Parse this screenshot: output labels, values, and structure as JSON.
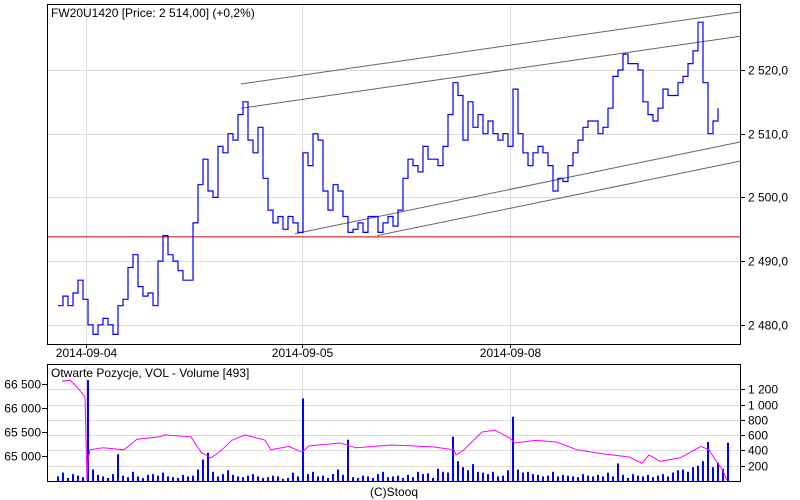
{
  "chart_data": [
    {
      "type": "line",
      "title": "FW20U1420 [Price: 2 514,00] (+0,2%)",
      "x_ticks": [
        {
          "label": "2014-09-04",
          "t": 5.6
        },
        {
          "label": "2014-09-05",
          "t": 48.8
        },
        {
          "label": "2014-09-08",
          "t": 90.4
        }
      ],
      "xlim": [
        -2.2,
        136.4
      ],
      "y_ticks": [
        {
          "label": "2 520,0",
          "value": 2520
        },
        {
          "label": "2 510,0",
          "value": 2510
        },
        {
          "label": "2 500,0",
          "value": 2500
        },
        {
          "label": "2 490,0",
          "value": 2490
        },
        {
          "label": "2 480,0",
          "value": 2480
        }
      ],
      "grid": true,
      "series": [
        {
          "name": "FW20U1420",
          "color": "#0000ff",
          "values": [
            2483,
            2484.5,
            2483,
            2485,
            2487,
            2484,
            2480,
            2478.5,
            2480,
            2481,
            2480,
            2478.5,
            2483,
            2484,
            2489,
            2491,
            2486,
            2484.5,
            2485,
            2483,
            2490,
            2494,
            2491,
            2490,
            2488.5,
            2487,
            2487,
            2496,
            2502,
            2506,
            2501,
            2500,
            2508,
            2507,
            2510,
            2509,
            2513,
            2515,
            2509,
            2507,
            2511,
            2503,
            2498,
            2496,
            2497,
            2495,
            2497,
            2496,
            2494.5,
            2507,
            2505,
            2510,
            2509,
            2501,
            2498,
            2502,
            2501,
            2497,
            2494.5,
            2495,
            2496,
            2494.5,
            2497,
            2497,
            2494.5,
            2496,
            2497,
            2495.5,
            2498,
            2503,
            2506,
            2505,
            2504,
            2508,
            2506,
            2506,
            2505,
            2508,
            2513,
            2518,
            2516,
            2509,
            2515,
            2511,
            2513,
            2510,
            2512,
            2510,
            2509,
            2510,
            2508,
            2517,
            2510,
            2507,
            2505,
            2507,
            2508,
            2507,
            2505,
            2501,
            2503,
            2502.5,
            2505,
            2507,
            2509,
            2511,
            2512,
            2512,
            2510,
            2511,
            2514,
            2519,
            2520,
            2522.5,
            2521,
            2521,
            2520,
            2515,
            2513,
            2512,
            2514,
            2517,
            2516,
            2516,
            2518,
            2519,
            2521,
            2523,
            2527.5,
            2518,
            2510,
            2512,
            2514
          ]
        }
      ],
      "reference_line": {
        "value": 2493.8,
        "color": "#cc0000"
      },
      "trendlines": [
        {
          "from": [
            36.6,
            2517.8
          ],
          "to": [
            136.4,
            2529.1
          ]
        },
        {
          "from": [
            36.6,
            2514.0
          ],
          "to": [
            136.4,
            2525.3
          ]
        },
        {
          "from": [
            47.4,
            2494.3
          ],
          "to": [
            136.4,
            2508.7
          ]
        },
        {
          "from": [
            63.8,
            2494.0
          ],
          "to": [
            136.4,
            2505.7
          ]
        }
      ]
    },
    {
      "type": "bar",
      "title": "Otwarte Pozycje, VOL - Volume [493]",
      "left_axis": {
        "name": "Otwarte Pozycje",
        "ticks": [
          {
            "label": "66 500",
            "value": 66500
          },
          {
            "label": "66 000",
            "value": 66000
          },
          {
            "label": "65 500",
            "value": 65500
          },
          {
            "label": "65 000",
            "value": 65000
          }
        ]
      },
      "right_axis": {
        "name": "Volume",
        "ticks": [
          {
            "label": "1 200",
            "value": 1200
          },
          {
            "label": "1 000",
            "value": 1000
          },
          {
            "label": "800",
            "value": 800
          },
          {
            "label": "600",
            "value": 600
          },
          {
            "label": "400",
            "value": 400
          },
          {
            "label": "200",
            "value": 200
          }
        ]
      },
      "open_interest": {
        "color": "#ff00ff",
        "points": [
          [
            0.8,
            66560
          ],
          [
            2.4,
            66580
          ],
          [
            3.8,
            66440
          ],
          [
            5.4,
            66230
          ],
          [
            5.8,
            64500
          ],
          [
            6,
            64920
          ],
          [
            6.4,
            65130
          ],
          [
            9,
            65170
          ],
          [
            13.2,
            65130
          ],
          [
            15.8,
            65350
          ],
          [
            20.4,
            65400
          ],
          [
            21.4,
            65440
          ],
          [
            26.6,
            65400
          ],
          [
            28.6,
            65080
          ],
          [
            30.6,
            64960
          ],
          [
            32.8,
            65130
          ],
          [
            34.8,
            65330
          ],
          [
            37.4,
            65440
          ],
          [
            41.4,
            65330
          ],
          [
            42.6,
            65130
          ],
          [
            46.2,
            65200
          ],
          [
            48.8,
            65080
          ],
          [
            50.2,
            65210
          ],
          [
            56.4,
            65270
          ],
          [
            59.6,
            65170
          ],
          [
            66.8,
            65230
          ],
          [
            75,
            65190
          ],
          [
            79.2,
            65130
          ],
          [
            79.6,
            65020
          ],
          [
            81.2,
            65130
          ],
          [
            84.8,
            65500
          ],
          [
            87.4,
            65540
          ],
          [
            90.4,
            65370
          ],
          [
            91.4,
            65270
          ],
          [
            95.6,
            65330
          ],
          [
            99.8,
            65290
          ],
          [
            103.8,
            65130
          ],
          [
            108,
            65060
          ],
          [
            114.2,
            64980
          ],
          [
            116.8,
            64850
          ],
          [
            118.2,
            65020
          ],
          [
            120.4,
            64890
          ],
          [
            124.4,
            64960
          ],
          [
            128.6,
            65200
          ],
          [
            130.2,
            65130
          ],
          [
            131.2,
            64960
          ],
          [
            132.8,
            64730
          ],
          [
            133.8,
            64500
          ]
        ]
      },
      "volume": {
        "color": "#0000ff",
        "values": [
          60,
          110,
          40,
          90,
          70,
          50,
          1320,
          150,
          80,
          60,
          40,
          90,
          350,
          70,
          50,
          120,
          60,
          40,
          80,
          90,
          70,
          110,
          60,
          50,
          40,
          80,
          60,
          70,
          150,
          280,
          370,
          120,
          60,
          90,
          140,
          80,
          60,
          50,
          70,
          90,
          60,
          40,
          50,
          70,
          60,
          30,
          40,
          110,
          60,
          1080,
          90,
          120,
          60,
          70,
          40,
          90,
          150,
          80,
          540,
          50,
          40,
          70,
          60,
          40,
          90,
          120,
          50,
          60,
          70,
          40,
          80,
          50,
          120,
          90,
          100,
          40,
          160,
          120,
          110,
          580,
          260,
          180,
          140,
          220,
          120,
          110,
          90,
          120,
          60,
          70,
          140,
          840,
          150,
          110,
          120,
          90,
          80,
          60,
          70,
          120,
          60,
          80,
          70,
          60,
          50,
          90,
          70,
          60,
          80,
          60,
          110,
          60,
          230,
          80,
          40,
          90,
          70,
          60,
          80,
          50,
          70,
          90,
          60,
          110,
          140,
          150,
          120,
          180,
          200,
          260,
          510,
          180,
          240,
          160,
          500
        ]
      }
    }
  ],
  "footer": {
    "copyright": "(C)Stooq"
  }
}
